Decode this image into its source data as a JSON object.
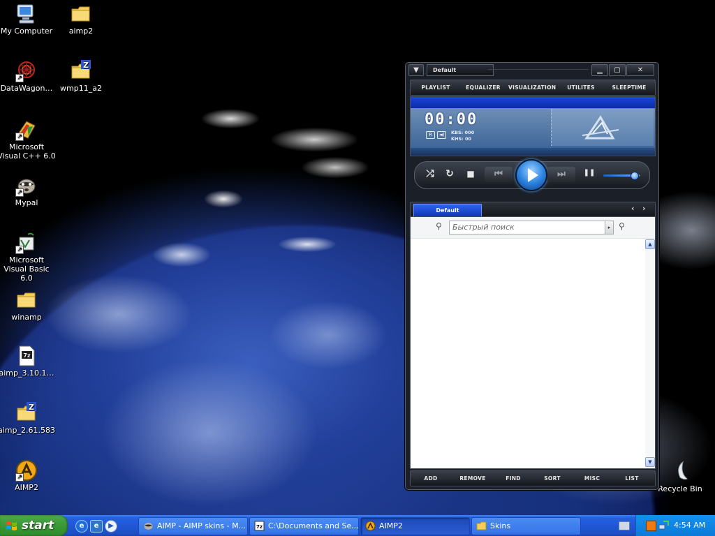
{
  "desktop": {
    "icons": [
      {
        "label": "My Computer"
      },
      {
        "label": "aimp2"
      },
      {
        "label": "DataWagon…"
      },
      {
        "label": "wmp11_a2"
      },
      {
        "label": "Microsoft Visual C++ 6.0"
      },
      {
        "label": "Mypal"
      },
      {
        "label": "Microsoft Visual Basic 6.0"
      },
      {
        "label": "winamp"
      },
      {
        "label": "aimp_3.10.1…"
      },
      {
        "label": "aimp_2.61.583"
      },
      {
        "label": "AIMP2"
      },
      {
        "label": "Recycle Bin"
      }
    ],
    "icon_glyphs": {
      "archive_z": "Z",
      "archive_7z": "7z",
      "shortcut": "↗"
    }
  },
  "player": {
    "title": "Default",
    "window_buttons": {
      "menu": "▼",
      "minimize": "▁",
      "maximize": "▢",
      "close": "✕"
    },
    "menu": [
      "PLAYLIST",
      "EQUALIZER",
      "VISUALIZATION",
      "UTILITES",
      "SLEEPTIME"
    ],
    "display": {
      "time": "00:00",
      "kbs": "KBS: 000",
      "khs": "KHS: 00",
      "icons": {
        "repeat": "R",
        "sound": "◄)"
      }
    },
    "controls": {
      "shuffle": "⤮",
      "repeat": "↻",
      "stop": "■",
      "prev": "⏮",
      "next": "⏭",
      "pause": "❚❚"
    },
    "volume": 0.85,
    "playlist": {
      "tab": "Default",
      "nav": {
        "prev": "‹",
        "next": "›"
      },
      "search_placeholder": "Быстрый поиск",
      "search_drop": "▸",
      "magnifier": "⚲",
      "scroll_up": "▲",
      "scroll_down": "▼"
    },
    "bottom": [
      "ADD",
      "REMOVE",
      "FIND",
      "SORT",
      "MISC",
      "LIST"
    ]
  },
  "taskbar": {
    "start": "start",
    "tasks": [
      {
        "label": "AIMP - AIMP skins - M..."
      },
      {
        "label": "C:\\Documents and Se..."
      },
      {
        "label": "AIMP2"
      },
      {
        "label": "Skins"
      }
    ],
    "tray_time": "4:54 AM",
    "colors": {
      "start_green": "#3a9a36",
      "taskbar_blue": "#2157d6",
      "tray_blue": "#0d7ad8"
    }
  }
}
